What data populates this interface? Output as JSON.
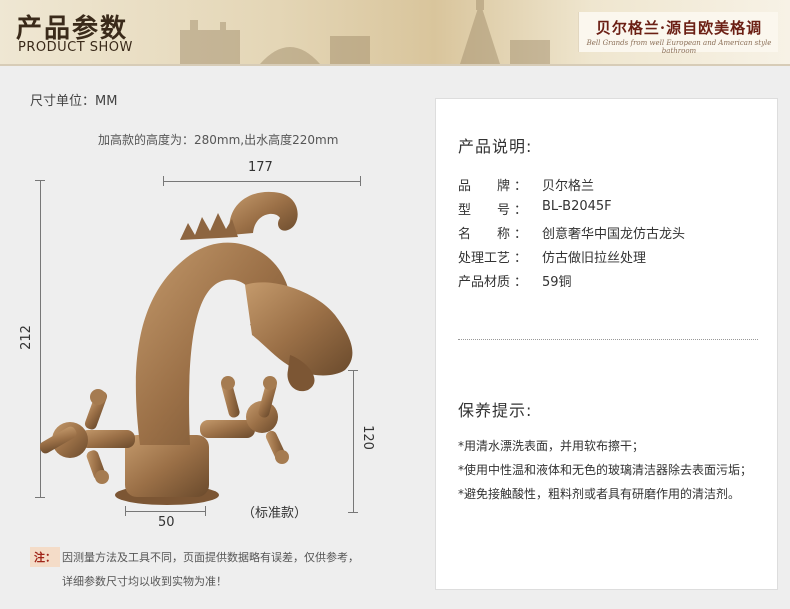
{
  "header": {
    "title_cn": "产品参数",
    "title_en": "PRODUCT SHOW",
    "tagline_cn": "贝尔格兰·源自欧美格调",
    "tagline_en": "Bell Grands from well European and American style bathroom"
  },
  "diagram": {
    "unit_label": "尺寸单位：MM",
    "height_note": "加高款的高度为：280mm,出水高度220mm",
    "dim_width": "177",
    "dim_height": "212",
    "dim_spout": "120",
    "dim_base": "50",
    "standard_label": "（标准款）"
  },
  "note": {
    "tag": "注：",
    "line1": "因测量方法及工具不同，页面提供数据略有误差，仅供参考，",
    "line2": "详细参数尺寸均以收到实物为准！"
  },
  "spec": {
    "title": "产品说明:",
    "rows": [
      {
        "key": "品　　牌",
        "value": "贝尔格兰"
      },
      {
        "key": "型　　号",
        "value": "BL-B2045F"
      },
      {
        "key": "名　　称",
        "value": "创意奢华中国龙仿古龙头"
      },
      {
        "key": "处理工艺",
        "value": "仿古做旧拉丝处理"
      },
      {
        "key": "产品材质",
        "value": "59铜"
      }
    ],
    "separator": "："
  },
  "care": {
    "title": "保养提示:",
    "items": [
      "*用清水漂洗表面，并用软布擦干；",
      "*使用中性温和液体和无色的玻璃清洁器除去表面污垢；",
      "*避免接触酸性，粗料剂或者具有研磨作用的清洁剂。"
    ]
  },
  "colors": {
    "brass": "#9b7047",
    "brand_red": "#6b1f14"
  }
}
